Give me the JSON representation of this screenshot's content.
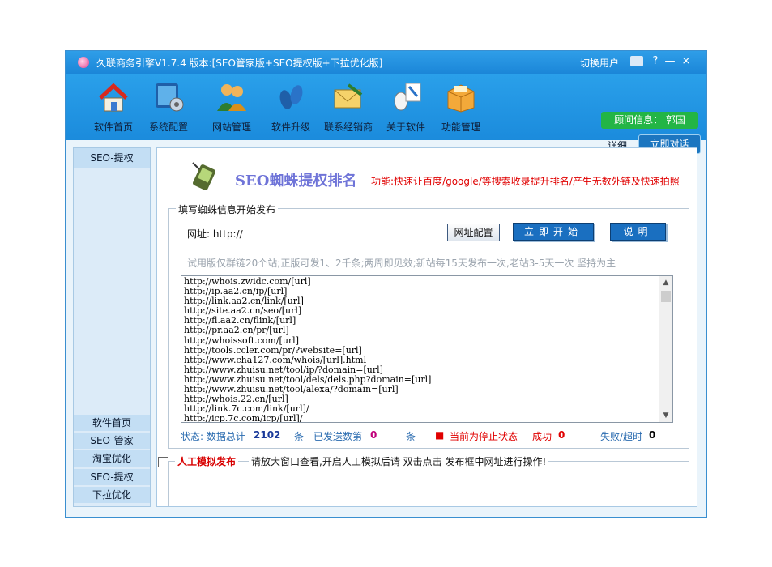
{
  "window": {
    "title": "久联商务引擎V1.7.4 版本:[SEO管家版+SEO提权版+下拉优化版]",
    "switch_user": "切换用户",
    "help": "?",
    "minimize": "—",
    "close": "×"
  },
  "toolbar": {
    "items": [
      {
        "label": "软件首页",
        "icon": "home-icon"
      },
      {
        "label": "系统配置",
        "icon": "settings-icon"
      },
      {
        "label": "网站管理",
        "icon": "users-icon"
      },
      {
        "label": "软件升级",
        "icon": "footprint-icon"
      },
      {
        "label": "联系经销商",
        "icon": "mail-icon"
      },
      {
        "label": "关于软件",
        "icon": "mouse-icon"
      },
      {
        "label": "功能管理",
        "icon": "box-icon"
      }
    ],
    "consultant": "顾问信息： 郭国",
    "detail": "详细",
    "chat": "立即对话"
  },
  "sidebar": {
    "header": "SEO-提权",
    "items": [
      "软件首页",
      "SEO-管家",
      "淘宝优化",
      "SEO-提权",
      "下拉优化"
    ]
  },
  "main": {
    "title": "SEO蜘蛛提权排名",
    "feature": "功能:快速让百度/google/等搜索收录提升排名/产生无数外链及快速拍照",
    "group_title": "填写蜘蛛信息开始发布",
    "url_label": "网址: http://",
    "url_value": "",
    "config_button": "网址配置",
    "start_button": "立即开始",
    "help_button": "说明",
    "trial_note": "试用版仅群链20个站;正版可发1、2千条;两周即见效;新站每15天发布一次,老站3-5天一次 坚持为主",
    "urls": [
      "http://whois.zwidc.com/[url]",
      "http://ip.aa2.cn/ip/[url]",
      "http://link.aa2.cn/link/[url]",
      "http://site.aa2.cn/seo/[url]",
      "http://fl.aa2.cn/flink/[url]",
      "http://pr.aa2.cn/pr/[url]",
      "http://whoissoft.com/[url]",
      "http://tools.ccler.com/pr/?website=[url]",
      "http://www.cha127.com/whois/[url].html",
      "http://www.zhuisu.net/tool/ip/?domain=[url]",
      "http://www.zhuisu.net/tool/dels/dels.php?domain=[url]",
      "http://www.zhuisu.net/tool/alexa/?domain=[url]",
      "http://whois.22.cn/[url]",
      "http://link.7c.com/link/[url]/",
      "http://icp.7c.com/icp/[url]/"
    ],
    "status": {
      "label": "状态: 数据总计",
      "total": "2102",
      "unit1": "条",
      "sent_label": "已发送数第",
      "sent": "0",
      "unit2": "条",
      "state_marker": "■",
      "state": "当前为停止状态",
      "success_label": "成功",
      "success": "0",
      "fail_label": "失败/超时",
      "fail": "0"
    },
    "manual": {
      "label": "人工模拟发布",
      "desc": "请放大窗口查看,开启人工模拟后请 双击点击 发布框中网址进行操作!"
    }
  },
  "colors": {
    "accent": "#1b86d8",
    "green": "#23b545",
    "red": "#e00000",
    "purple": "#6f74d8"
  }
}
